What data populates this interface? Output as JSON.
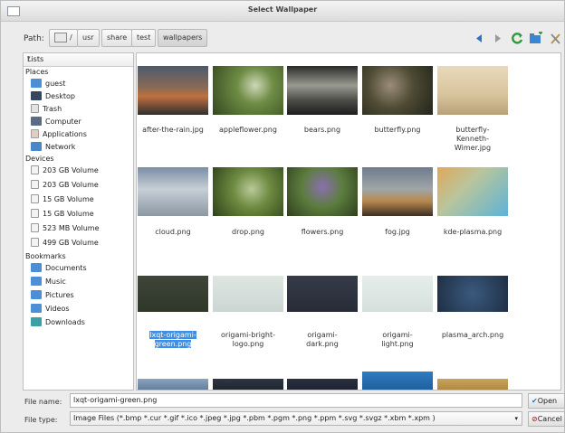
{
  "window": {
    "title": "Select Wallpaper"
  },
  "path": {
    "label": "Path:",
    "segments": [
      "/",
      "usr",
      "share",
      "test",
      "wallpapers"
    ]
  },
  "sidebar": {
    "combo_value": "Lists",
    "places_header": "Places",
    "places": [
      {
        "label": "guest",
        "icon": "home-folder-icon"
      },
      {
        "label": "Desktop",
        "icon": "desktop-icon"
      },
      {
        "label": "Trash",
        "icon": "trash-icon"
      },
      {
        "label": "Computer",
        "icon": "computer-icon"
      },
      {
        "label": "Applications",
        "icon": "applications-icon"
      },
      {
        "label": "Network",
        "icon": "network-icon"
      }
    ],
    "devices_header": "Devices",
    "devices": [
      {
        "label": "203 GB Volume"
      },
      {
        "label": "203 GB Volume"
      },
      {
        "label": "15 GB Volume"
      },
      {
        "label": "15 GB Volume"
      },
      {
        "label": "523 MB Volume"
      },
      {
        "label": "499 GB Volume"
      }
    ],
    "bookmarks_header": "Bookmarks",
    "bookmarks": [
      {
        "label": "Documents"
      },
      {
        "label": "Music"
      },
      {
        "label": "Pictures"
      },
      {
        "label": "Videos"
      },
      {
        "label": "Downloads"
      }
    ]
  },
  "files": [
    {
      "name": "after-the-rain.jpg"
    },
    {
      "name": "appleflower.png"
    },
    {
      "name": "bears.png"
    },
    {
      "name": "butterfly.png"
    },
    {
      "name": "butterfly-Kenneth-Wimer.jpg",
      "lines": [
        "butterfly-",
        "Kenneth-",
        "Wimer.jpg"
      ]
    },
    {
      "name": "cloud.png"
    },
    {
      "name": "drop.png"
    },
    {
      "name": "flowers.png"
    },
    {
      "name": "fog.jpg"
    },
    {
      "name": "kde-plasma.png"
    },
    {
      "name": "lxqt-origami-green.png",
      "lines": [
        "lxqt-origami-",
        "green.png"
      ],
      "selected": true
    },
    {
      "name": "origami-bright-logo.png",
      "lines": [
        "origami-bright-",
        "logo.png"
      ]
    },
    {
      "name": "origami-dark.png",
      "lines": [
        "origami-",
        "dark.png"
      ]
    },
    {
      "name": "origami-light.png",
      "lines": [
        "origami-",
        "light.png"
      ]
    },
    {
      "name": "plasma_arch.png"
    }
  ],
  "filename": {
    "label": "File name:",
    "value": "lxqt-origami-green.png"
  },
  "filetype": {
    "label": "File type:",
    "value": "Image Files (*.bmp *.cur *.gif *.ico *.jpeg *.jpg *.pbm *.pgm *.png *.ppm *.svg *.svgz *.xbm *.xpm )"
  },
  "buttons": {
    "open": "Open",
    "cancel": "Cancel"
  }
}
